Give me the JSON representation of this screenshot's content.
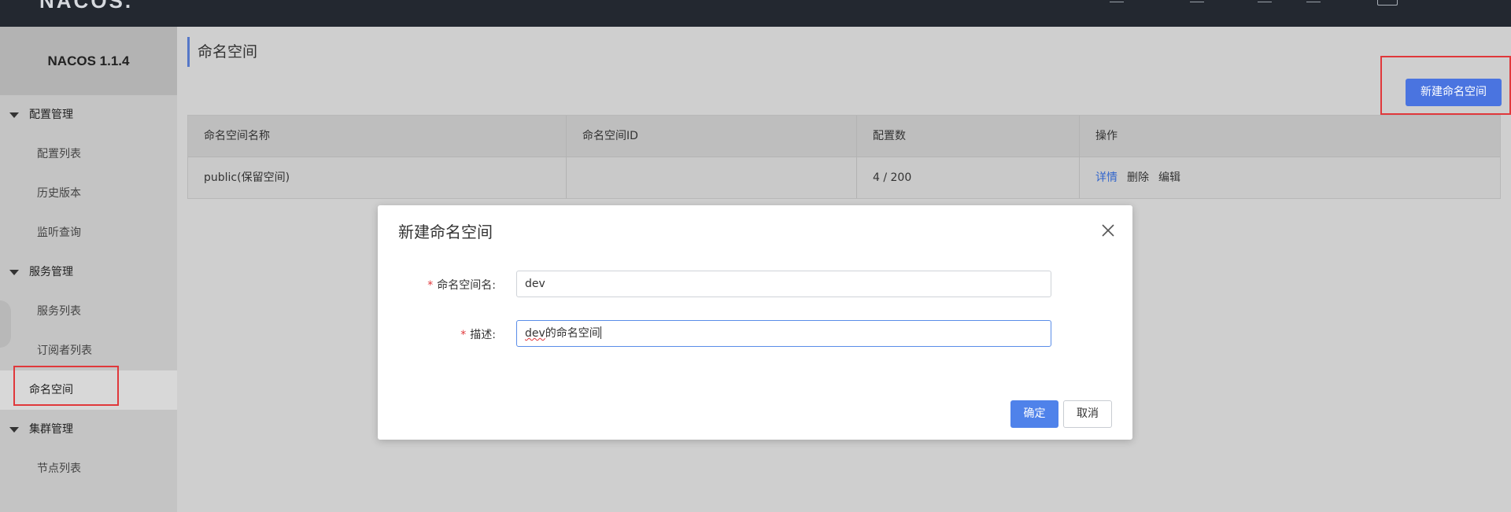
{
  "topbar": {
    "logo": "NACOS."
  },
  "sidebar": {
    "brand": "NACOS 1.1.4",
    "groups": [
      {
        "label": "配置管理",
        "items": [
          "配置列表",
          "历史版本",
          "监听查询"
        ]
      },
      {
        "label": "服务管理",
        "items": [
          "服务列表",
          "订阅者列表",
          "命名空间"
        ]
      },
      {
        "label": "集群管理",
        "items": [
          "节点列表"
        ]
      }
    ]
  },
  "main": {
    "title": "命名空间",
    "new_button": "新建命名空间",
    "table": {
      "headers": [
        "命名空间名称",
        "命名空间ID",
        "配置数",
        "操作"
      ],
      "rows": [
        {
          "name": "public(保留空间)",
          "id": "",
          "count": "4 / 200",
          "ops": [
            "详情",
            "删除",
            "编辑"
          ]
        }
      ]
    }
  },
  "modal": {
    "title": "新建命名空间",
    "fields": [
      {
        "label": "命名空间名:",
        "value": "dev"
      },
      {
        "label": "描述:",
        "value_misspelled": "dev",
        "value_rest": "的命名空间"
      }
    ],
    "ok": "确定",
    "cancel": "取消"
  },
  "colors": {
    "primary": "#4a74e0",
    "required": "#e0383b",
    "highlight": "#e0383b",
    "link": "#3366cc"
  }
}
